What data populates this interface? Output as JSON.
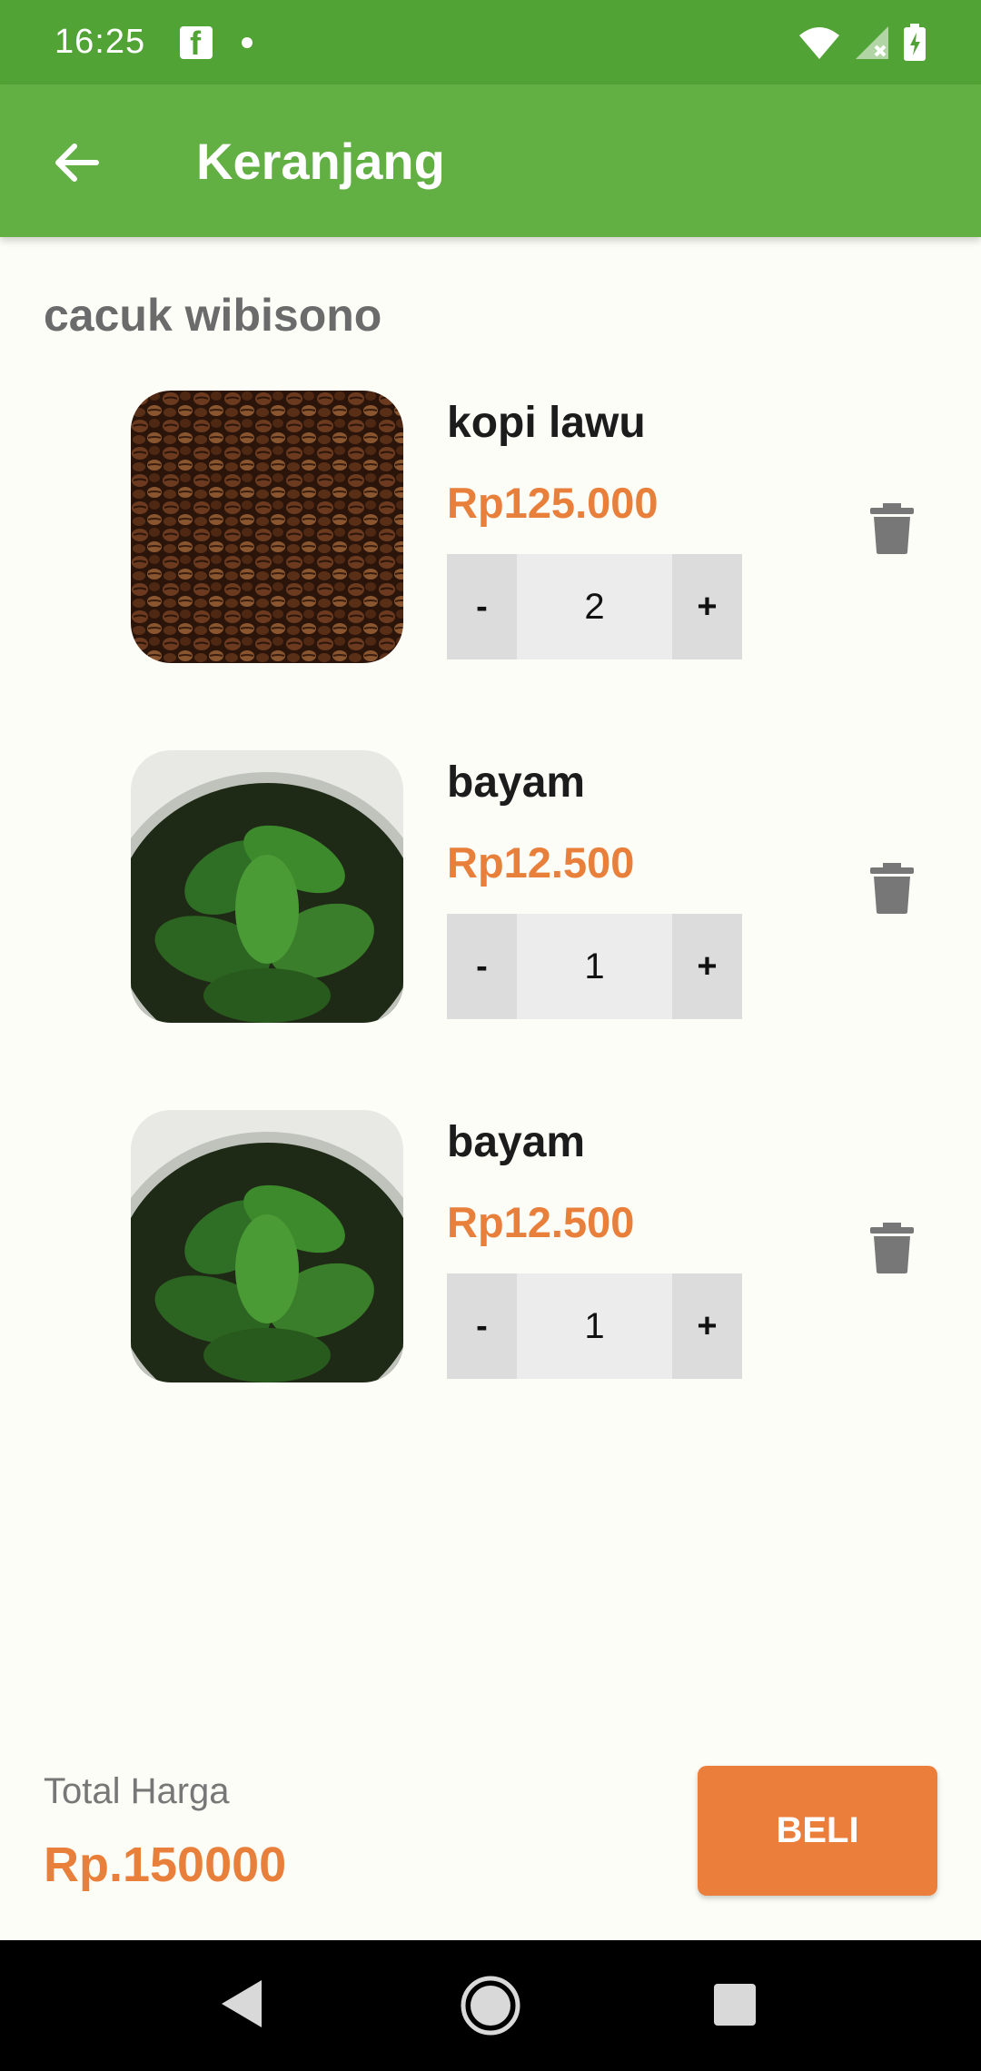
{
  "status_bar": {
    "time": "16:25",
    "icons": [
      "facebook-icon",
      "notification-dot-icon",
      "wifi-icon",
      "signal-icon",
      "battery-icon"
    ]
  },
  "app_bar": {
    "title": "Keranjang",
    "back_icon": "arrow-back-icon"
  },
  "seller": {
    "name": "cacuk wibisono"
  },
  "cart": {
    "items": [
      {
        "name": "kopi lawu",
        "price": "Rp125.000",
        "quantity": "2",
        "minus": "-",
        "plus": "+",
        "image": "coffee-beans"
      },
      {
        "name": "bayam",
        "price": "Rp12.500",
        "quantity": "1",
        "minus": "-",
        "plus": "+",
        "image": "spinach"
      },
      {
        "name": "bayam",
        "price": "Rp12.500",
        "quantity": "1",
        "minus": "-",
        "plus": "+",
        "image": "spinach"
      }
    ]
  },
  "footer": {
    "total_label": "Total Harga",
    "total_value": "Rp.150000",
    "buy_label": "BELI"
  },
  "nav_bar": {
    "icons": [
      "back-triangle-icon",
      "home-circle-icon",
      "recents-square-icon"
    ]
  },
  "colors": {
    "status_bar": "#52a336",
    "app_bar": "#62b043",
    "accent": "#ec7e3b",
    "price": "#e8803c",
    "background": "#fdfdf7"
  }
}
